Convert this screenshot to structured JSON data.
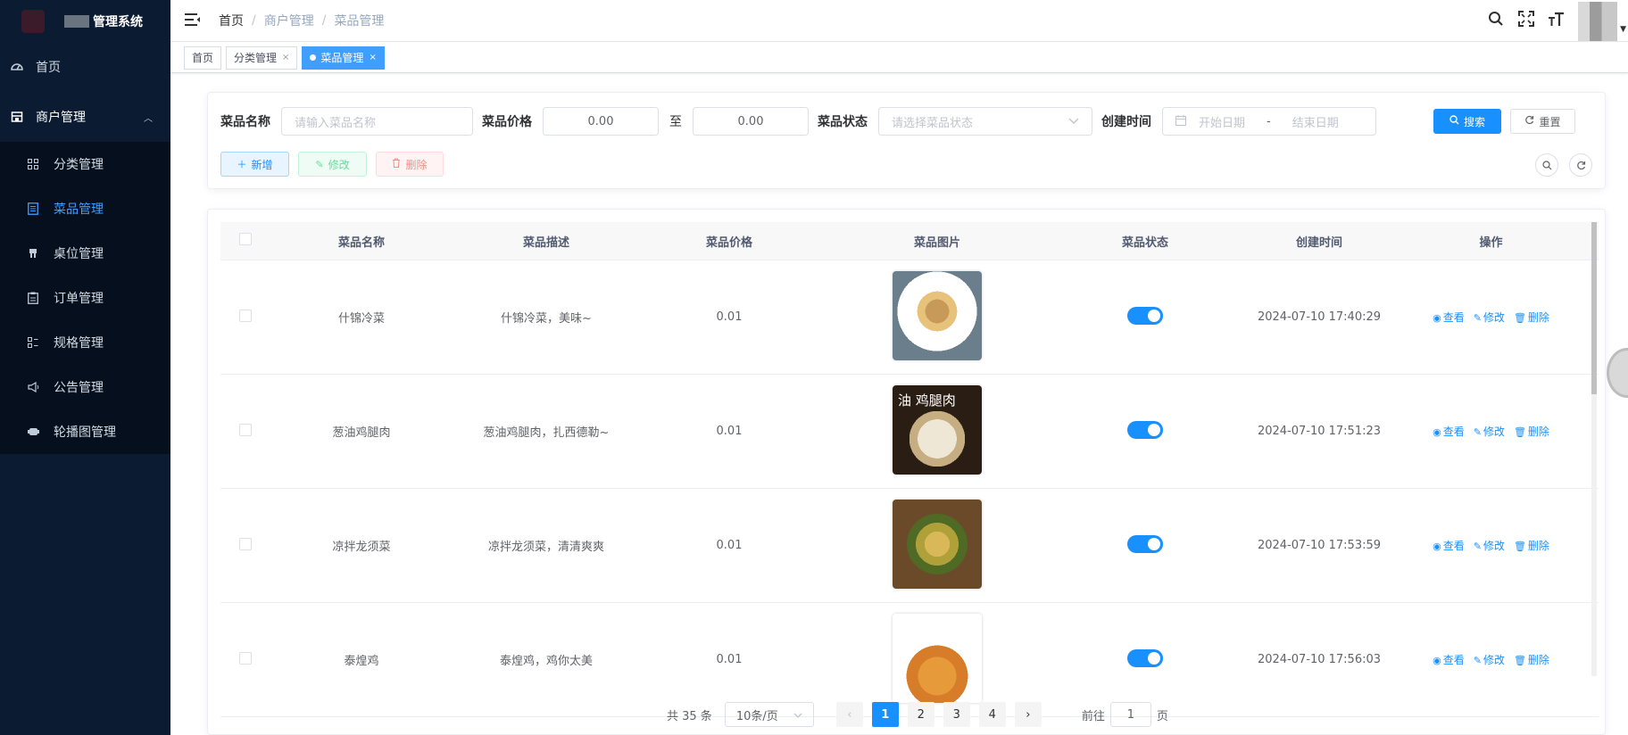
{
  "app": {
    "title": "管理系统"
  },
  "sidebar": {
    "home": "首页",
    "group": "商户管理",
    "items": [
      {
        "label": "分类管理",
        "icon": "grid-icon"
      },
      {
        "label": "菜品管理",
        "icon": "list-icon"
      },
      {
        "label": "桌位管理",
        "icon": "table-icon"
      },
      {
        "label": "订单管理",
        "icon": "clipboard-icon"
      },
      {
        "label": "规格管理",
        "icon": "spec-icon"
      },
      {
        "label": "公告管理",
        "icon": "megaphone-icon"
      },
      {
        "label": "轮播图管理",
        "icon": "carousel-icon"
      }
    ]
  },
  "breadcrumb": {
    "home": "首页",
    "level1": "商户管理",
    "level2": "菜品管理"
  },
  "tags": [
    {
      "label": "首页"
    },
    {
      "label": "分类管理"
    },
    {
      "label": "菜品管理"
    }
  ],
  "search": {
    "name_label": "菜品名称",
    "name_placeholder": "请输入菜品名称",
    "price_label": "菜品价格",
    "price_min": "0.00",
    "price_to": "至",
    "price_max": "0.00",
    "status_label": "菜品状态",
    "status_placeholder": "请选择菜品状态",
    "time_label": "创建时间",
    "start_placeholder": "开始日期",
    "date_sep": "-",
    "end_placeholder": "结束日期",
    "search_button": "搜索",
    "reset_button": "重置"
  },
  "actions": {
    "add": "新增",
    "edit": "修改",
    "delete": "删除"
  },
  "table": {
    "headers": [
      "菜品名称",
      "菜品描述",
      "菜品价格",
      "菜品图片",
      "菜品状态",
      "创建时间",
      "操作"
    ],
    "ops": {
      "view": "查看",
      "edit": "修改",
      "delete": "删除"
    },
    "rows": [
      {
        "name": "什锦冷菜",
        "desc": "什锦冷菜，美味~",
        "price": "0.01",
        "status_on": true,
        "created": "2024-07-10 17:40:29"
      },
      {
        "name": "葱油鸡腿肉",
        "desc": "葱油鸡腿肉，扎西德勒~",
        "price": "0.01",
        "status_on": true,
        "created": "2024-07-10 17:51:23",
        "image_text": "油 鸡腿肉"
      },
      {
        "name": "凉拌龙须菜",
        "desc": "凉拌龙须菜，清清爽爽",
        "price": "0.01",
        "status_on": true,
        "created": "2024-07-10 17:53:59"
      },
      {
        "name": "泰煌鸡",
        "desc": "泰煌鸡，鸡你太美",
        "price": "0.01",
        "status_on": true,
        "created": "2024-07-10 17:56:03"
      }
    ]
  },
  "pagination": {
    "total": "共 35 条",
    "page_size": "10条/页",
    "pages": [
      "1",
      "2",
      "3",
      "4"
    ],
    "current": "1",
    "goto_label": "前往",
    "goto_value": "1",
    "goto_suffix": "页"
  },
  "colors": {
    "primary": "#1890ff",
    "sidebar_bg": "#0b1b32",
    "active_menu": "#409eff"
  }
}
